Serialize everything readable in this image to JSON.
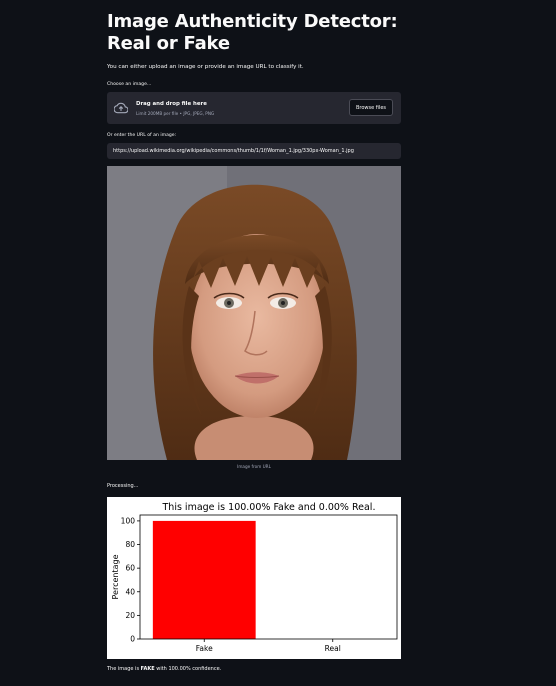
{
  "page": {
    "title": "Image Authenticity Detector: Real or Fake",
    "subtitle": "You can either upload an image or provide an image URL to classify it."
  },
  "uploader": {
    "label": "Choose an image...",
    "drag_text": "Drag and drop file here",
    "limit_text": "Limit 200MB per file • JPG, JPEG, PNG",
    "browse_label": "Browse files",
    "icon": "cloud-upload-icon"
  },
  "url_input": {
    "label": "Or enter the URL of an image:",
    "value": "https://upload.wikimedia.org/wikipedia/commons/thumb/1/1f/Woman_1.jpg/330px-Woman_1.jpg"
  },
  "image": {
    "caption": "Image from URL"
  },
  "status": {
    "processing": "Processing...",
    "result_prefix": "The image is ",
    "result_label": "FAKE",
    "result_suffix": " with 100.00% confidence."
  },
  "chart_data": {
    "type": "bar",
    "title": "This image is 100.00% Fake and 0.00% Real.",
    "categories": [
      "Fake",
      "Real"
    ],
    "values": [
      100,
      0
    ],
    "colors": [
      "#ff0000",
      "#008000"
    ],
    "ylabel": "Percentage",
    "xlabel": "",
    "ylim": [
      0,
      105
    ],
    "yticks": [
      0,
      20,
      40,
      60,
      80,
      100
    ],
    "grid": false
  }
}
